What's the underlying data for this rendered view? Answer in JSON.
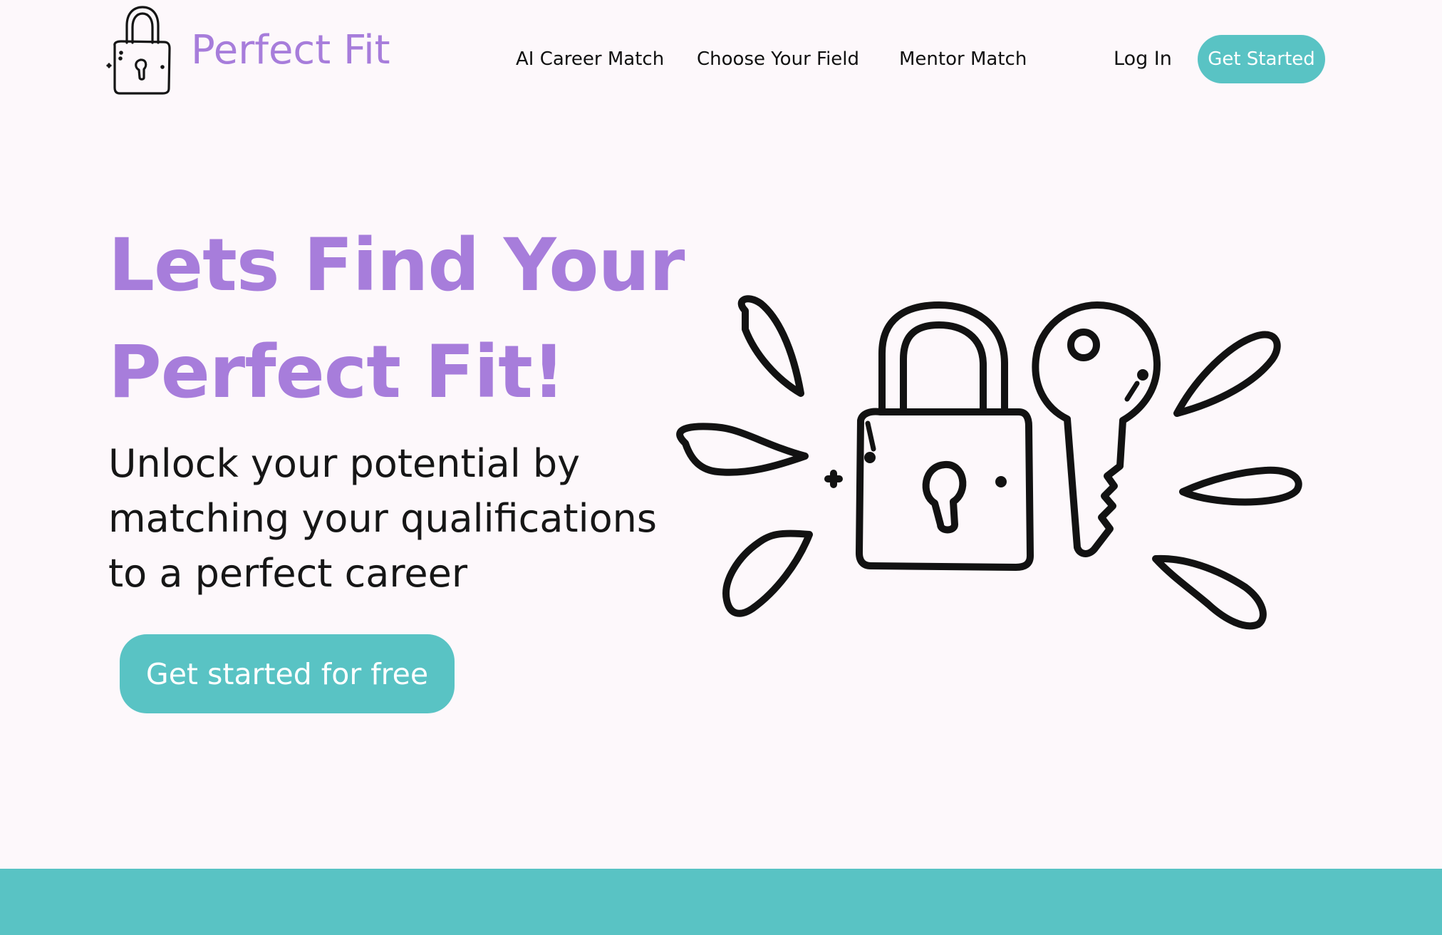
{
  "brand": {
    "name": "Perfect Fit",
    "logo_icon": "padlock-icon",
    "color": "#a77ddb"
  },
  "nav": {
    "items": [
      {
        "label": "AI Career Match"
      },
      {
        "label": "Choose Your Field"
      },
      {
        "label": "Mentor Match"
      }
    ],
    "login_label": "Log In",
    "cta_label": "Get Started"
  },
  "hero": {
    "title_lines": [
      "Lets Find Your",
      "Perfect Fit!"
    ],
    "subtitle_lines": [
      "Unlock your potential by",
      "matching your qualifications",
      "to a perfect career"
    ],
    "cta_label": "Get started for free",
    "illustration": "lock-and-key-icon"
  },
  "colors": {
    "accent_teal": "#59c3c4",
    "accent_purple": "#a77ddb",
    "background": "#fdf8fb",
    "text": "#161616"
  }
}
